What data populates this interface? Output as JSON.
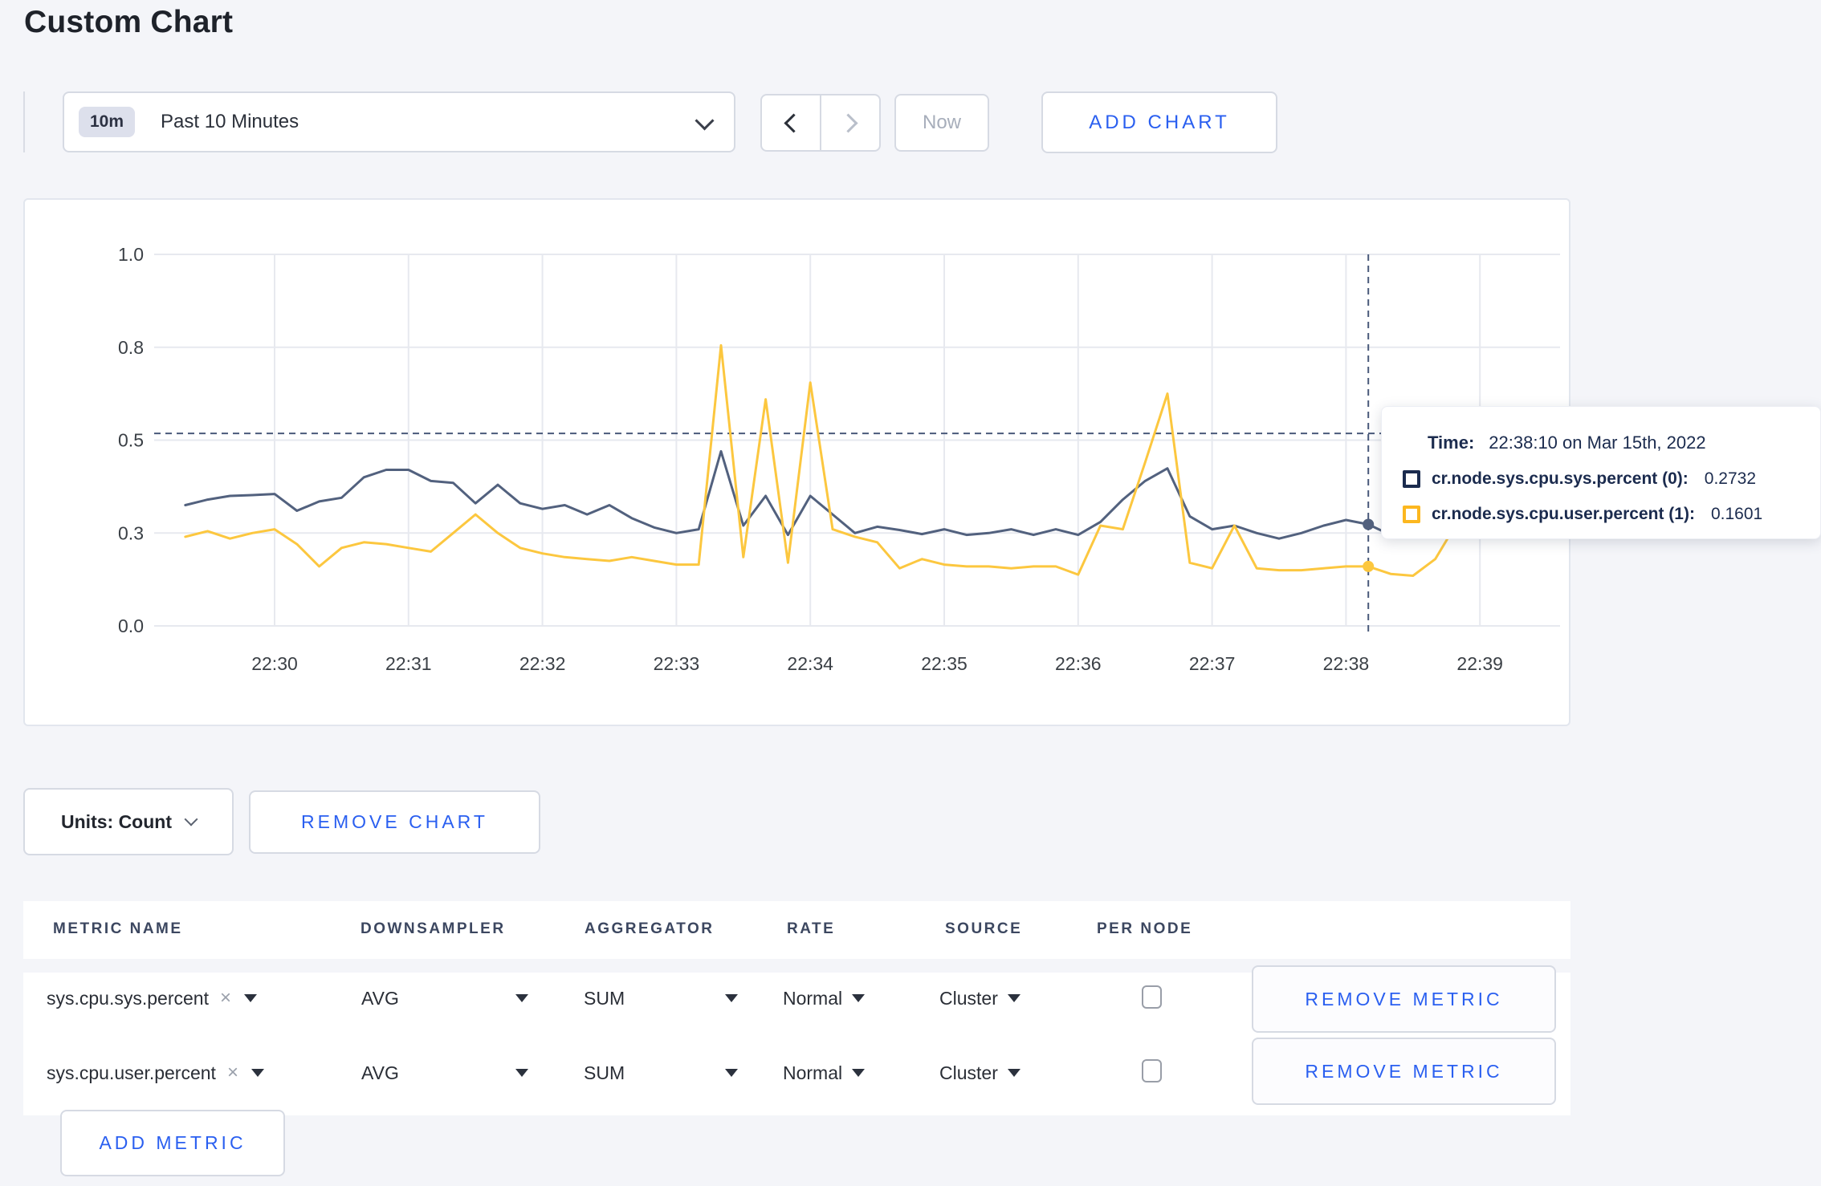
{
  "page": {
    "title": "Custom Chart"
  },
  "colors": {
    "accent_blue": "#2a5ff0",
    "page_background": "#f4f5f9",
    "gridline": "#e7e9ef",
    "crosshair": "#49597a",
    "series_sys": "#52617e",
    "series_user": "#fcc73f"
  },
  "icons": {
    "clear": "×",
    "time_range_chevron": "chevron-down",
    "prev": "chevron-left",
    "next": "chevron-right",
    "dropdown_caret": "caret-down"
  },
  "toolbar": {
    "time_range": {
      "badge": "10m",
      "label": "Past 10 Minutes"
    },
    "now_label": "Now",
    "add_chart_label": "ADD CHART"
  },
  "chart_footer": {
    "units_label": "Units: Count",
    "remove_chart_label": "REMOVE CHART"
  },
  "tooltip": {
    "time_label": "Time:",
    "time_value": "22:38:10 on Mar 15th, 2022",
    "rows": [
      {
        "label": "cr.node.sys.cpu.sys.percent (0):",
        "value": "0.2732",
        "swatch_color": "#1b2b4e"
      },
      {
        "label": "cr.node.sys.cpu.user.percent (1):",
        "value": "0.1601",
        "swatch_color": "#fcb71f"
      }
    ]
  },
  "chart_data": {
    "type": "line",
    "title": "",
    "xlabel": "",
    "ylabel": "",
    "ylim": [
      0,
      1
    ],
    "grid": true,
    "legend_position": "tooltip-right",
    "x_ticks": [
      "22:30",
      "22:31",
      "22:32",
      "22:33",
      "22:34",
      "22:35",
      "22:36",
      "22:37",
      "22:38",
      "22:39"
    ],
    "y_ticks": [
      {
        "value": 0,
        "label": "0.0"
      },
      {
        "value": 0.25,
        "label": "0.3"
      },
      {
        "value": 0.5,
        "label": "0.5"
      },
      {
        "value": 0.75,
        "label": "0.8"
      },
      {
        "value": 1,
        "label": "1.0"
      }
    ],
    "x_start_offset_seconds": -40,
    "x_step_seconds": 10,
    "seconds_per_tick": 60,
    "series": [
      {
        "name": "cr.node.sys.cpu.sys.percent",
        "color": "#52617e",
        "values": [
          0.325,
          0.34,
          0.35,
          0.352,
          0.355,
          0.31,
          0.335,
          0.345,
          0.4,
          0.42,
          0.42,
          0.39,
          0.385,
          0.33,
          0.38,
          0.33,
          0.315,
          0.325,
          0.3,
          0.325,
          0.29,
          0.265,
          0.25,
          0.26,
          0.47,
          0.27,
          0.35,
          0.245,
          0.35,
          0.3,
          0.25,
          0.267,
          0.258,
          0.247,
          0.26,
          0.245,
          0.25,
          0.26,
          0.245,
          0.26,
          0.245,
          0.28,
          0.34,
          0.39,
          0.424,
          0.295,
          0.26,
          0.27,
          0.25,
          0.235,
          0.25,
          0.27,
          0.285,
          0.2732,
          0.245,
          0.26,
          0.28,
          0.29,
          0.3,
          0.295
        ]
      },
      {
        "name": "cr.node.sys.cpu.user.percent",
        "color": "#fcc73f",
        "values": [
          0.24,
          0.255,
          0.235,
          0.25,
          0.26,
          0.22,
          0.16,
          0.21,
          0.225,
          0.22,
          0.21,
          0.2,
          0.25,
          0.3,
          0.25,
          0.21,
          0.195,
          0.185,
          0.18,
          0.175,
          0.185,
          0.175,
          0.165,
          0.165,
          0.755,
          0.185,
          0.61,
          0.17,
          0.655,
          0.26,
          0.24,
          0.225,
          0.155,
          0.18,
          0.165,
          0.16,
          0.16,
          0.155,
          0.16,
          0.16,
          0.138,
          0.27,
          0.26,
          0.44,
          0.625,
          0.17,
          0.155,
          0.27,
          0.155,
          0.15,
          0.15,
          0.155,
          0.16,
          0.1601,
          0.14,
          0.135,
          0.18,
          0.28,
          0.26,
          0.25
        ]
      }
    ],
    "hover": {
      "index": 53,
      "time": "22:38:10",
      "crosshair_value": 0.518
    }
  },
  "metrics_table": {
    "headers": [
      "METRIC NAME",
      "DOWNSAMPLER",
      "AGGREGATOR",
      "RATE",
      "SOURCE",
      "PER NODE"
    ],
    "rows": [
      {
        "name": "sys.cpu.sys.percent",
        "downsampler": "AVG",
        "aggregator": "SUM",
        "rate": "Normal",
        "source": "Cluster",
        "per_node_checked": false,
        "remove_label": "REMOVE METRIC"
      },
      {
        "name": "sys.cpu.user.percent",
        "downsampler": "AVG",
        "aggregator": "SUM",
        "rate": "Normal",
        "source": "Cluster",
        "per_node_checked": false,
        "remove_label": "REMOVE METRIC"
      }
    ],
    "add_metric_label": "ADD METRIC"
  }
}
